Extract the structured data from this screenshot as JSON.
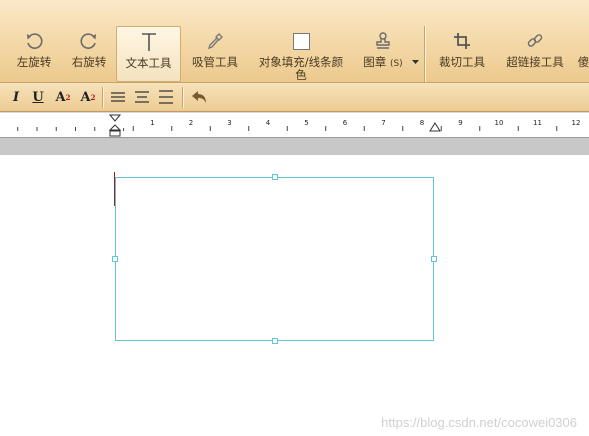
{
  "toolbar": {
    "buttons": [
      {
        "label": "左旋转",
        "icon": "rotate-left-icon"
      },
      {
        "label": "右旋转",
        "icon": "rotate-right-icon"
      },
      {
        "label": "文本工具",
        "icon": "text-tool-icon",
        "active": true
      },
      {
        "label": "吸管工具",
        "icon": "eyedropper-icon"
      },
      {
        "label": "对象填充/线条颜",
        "label2": "色",
        "icon": "fill-color-icon"
      },
      {
        "label": "图章",
        "suffix": "(S)",
        "icon": "stamp-icon"
      },
      {
        "label": "裁切工具",
        "icon": "crop-icon"
      },
      {
        "label": "超链接工具",
        "icon": "link-icon"
      },
      {
        "label": "傻",
        "icon": "partial-icon"
      }
    ]
  },
  "format": {
    "italic": "I",
    "underline": "U",
    "superscript": {
      "base": "A",
      "script": "2"
    },
    "subscript": {
      "base": "A",
      "script": "2"
    }
  },
  "ruler": {
    "numbers": [
      "1",
      "2",
      "3",
      "4",
      "5",
      "6",
      "7",
      "8",
      "9",
      "10",
      "11",
      "12"
    ]
  },
  "watermark": "https://blog.csdn.net/cocowei0306",
  "colors": {
    "toolbar": "#f3d8a6",
    "selection": "#61c6d2",
    "caret": "#b01818"
  }
}
